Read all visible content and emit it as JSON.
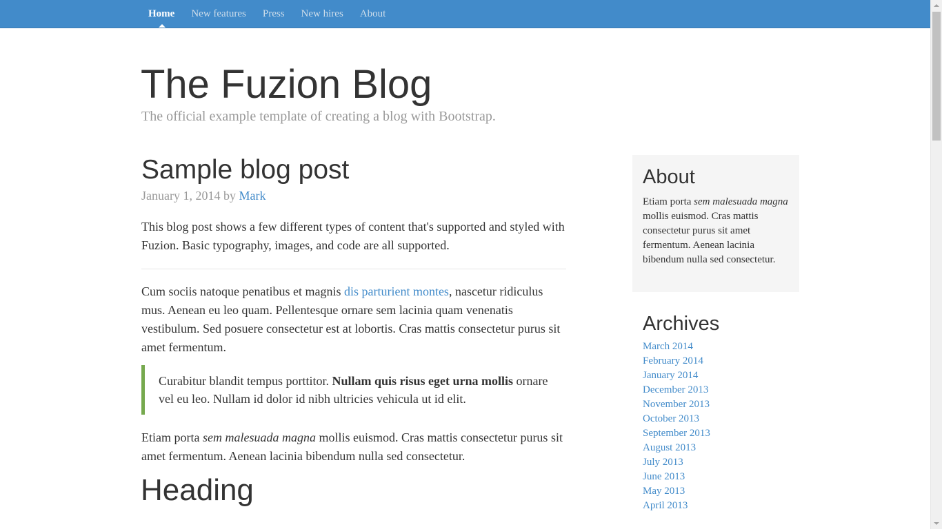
{
  "nav": {
    "items": [
      {
        "label": "Home",
        "active": true
      },
      {
        "label": "New features",
        "active": false
      },
      {
        "label": "Press",
        "active": false
      },
      {
        "label": "New hires",
        "active": false
      },
      {
        "label": "About",
        "active": false
      }
    ]
  },
  "header": {
    "title": "The Fuzion Blog",
    "description": "The official example template of creating a blog with Bootstrap."
  },
  "post": {
    "title": "Sample blog post",
    "meta_date": "January 1, 2014 by",
    "meta_author": "Mark",
    "intro": "This blog post shows a few different types of content that's supported and styled with Fuzion. Basic typography, images, and code are all supported.",
    "p2_before_link": "Cum sociis natoque penatibus et magnis ",
    "p2_link": "dis parturient montes",
    "p2_after_link": ", nascetur ridiculus mus. Aenean eu leo quam. Pellentesque ornare sem lacinia quam venenatis vestibulum. Sed posuere consectetur est at lobortis. Cras mattis consectetur purus sit amet fermentum.",
    "quote_before": "Curabitur blandit tempus porttitor. ",
    "quote_bold": "Nullam quis risus eget urna mollis",
    "quote_after": " ornare vel eu leo. Nullam id dolor id nibh ultricies vehicula ut id elit.",
    "p3_before": "Etiam porta ",
    "p3_italic": "sem malesuada magna",
    "p3_after": " mollis euismod. Cras mattis consectetur purus sit amet fermentum. Aenean lacinia bibendum nulla sed consectetur.",
    "heading": "Heading"
  },
  "sidebar": {
    "about": {
      "title": "About",
      "text_before": "Etiam porta ",
      "text_italic": "sem malesuada magna",
      "text_after": " mollis euismod. Cras mattis consectetur purus sit amet fermentum. Aenean lacinia bibendum nulla sed consectetur."
    },
    "archives": {
      "title": "Archives",
      "items": [
        "March 2014",
        "February 2014",
        "January 2014",
        "December 2013",
        "November 2013",
        "October 2013",
        "September 2013",
        "August 2013",
        "July 2013",
        "June 2013",
        "May 2013",
        "April 2013"
      ]
    }
  },
  "colors": {
    "navbar": "#428bca",
    "link": "#428bca",
    "blockquote_border": "#76a94e",
    "sidebar_module": "#f5f5f5",
    "muted_text": "#999999"
  }
}
